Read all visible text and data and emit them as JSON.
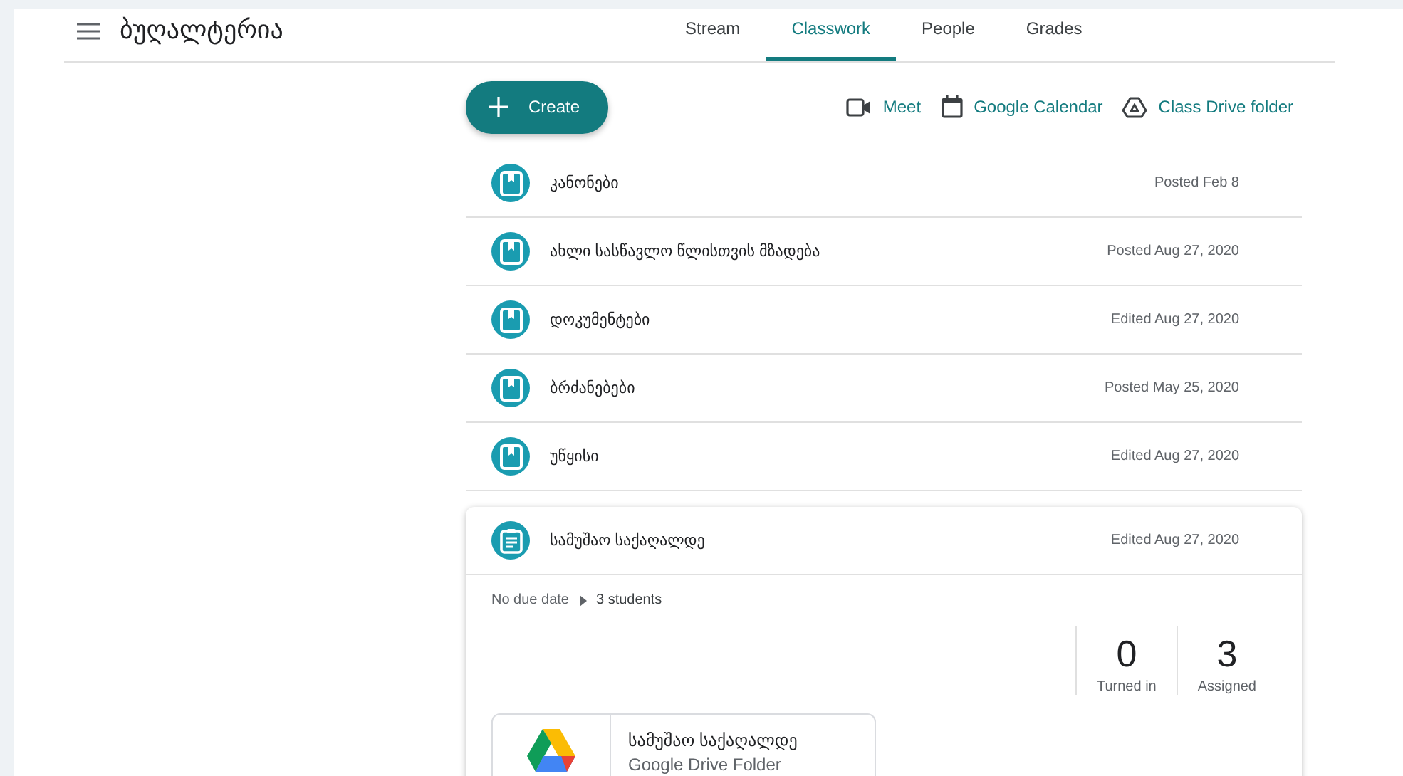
{
  "class_title": "ბუღალტერია",
  "tabs": [
    {
      "label": "Stream",
      "selected": false
    },
    {
      "label": "Classwork",
      "selected": true
    },
    {
      "label": "People",
      "selected": false
    },
    {
      "label": "Grades",
      "selected": false
    }
  ],
  "create_button": "Create",
  "links": [
    {
      "kind": "meet",
      "label": "Meet"
    },
    {
      "kind": "calendar",
      "label": "Google Calendar"
    },
    {
      "kind": "drive",
      "label": "Class Drive folder"
    }
  ],
  "items": [
    {
      "kind": "material",
      "title": "კანონები",
      "date": "Posted Feb 8"
    },
    {
      "kind": "material",
      "title": "ახლი სასწავლო წლისთვის მზადება",
      "date": "Posted Aug 27, 2020"
    },
    {
      "kind": "material",
      "title": "დოკუმენტები",
      "date": "Edited Aug 27, 2020"
    },
    {
      "kind": "material",
      "title": "ბრძანებები",
      "date": "Posted May 25, 2020"
    },
    {
      "kind": "material",
      "title": "უწყისი",
      "date": "Edited Aug 27, 2020"
    },
    {
      "kind": "assignment",
      "title": "სამუშაო საქაღალდე",
      "date": "Edited Aug 27, 2020",
      "expanded": true,
      "due": "No due date",
      "students": "3 students",
      "stats": [
        {
          "count": "0",
          "label": "Turned in"
        },
        {
          "count": "3",
          "label": "Assigned"
        }
      ],
      "attachment": {
        "title": "სამუშაო საქაღალდე",
        "subtitle": "Google Drive Folder"
      }
    }
  ]
}
